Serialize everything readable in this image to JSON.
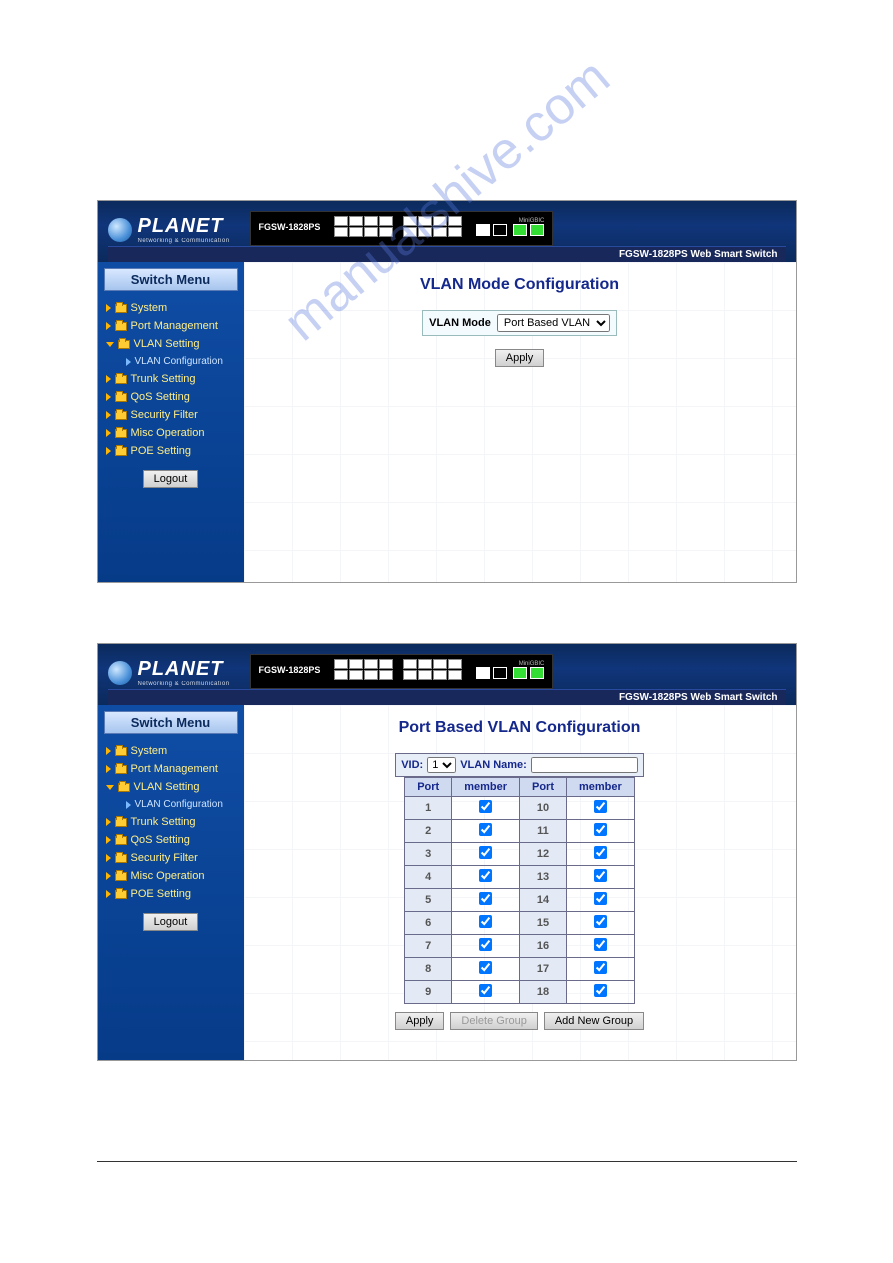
{
  "brand": {
    "name": "PLANET",
    "tagline": "Networking & Communication"
  },
  "device_model": "FGSW-1828PS",
  "minigbic_label": "MiniGBIC",
  "header_tag": "FGSW-1828PS Web Smart Switch",
  "sidebar": {
    "title": "Switch Menu",
    "items": [
      {
        "label": "System"
      },
      {
        "label": "Port Management"
      },
      {
        "label": "VLAN Setting",
        "expanded": true
      },
      {
        "label": "VLAN Configuration",
        "sub": true
      },
      {
        "label": "Trunk Setting"
      },
      {
        "label": "QoS Setting"
      },
      {
        "label": "Security Filter"
      },
      {
        "label": "Misc Operation"
      },
      {
        "label": "POE Setting"
      }
    ],
    "logout": "Logout"
  },
  "screen1": {
    "title": "VLAN Mode Configuration",
    "mode_label": "VLAN Mode",
    "mode_value": "Port Based VLAN",
    "apply": "Apply"
  },
  "screen2": {
    "title": "Port Based VLAN Configuration",
    "vid_label": "VID:",
    "vid_value": "1",
    "vlan_name_label": "VLAN Name:",
    "vlan_name_value": "",
    "col_port": "Port",
    "col_member": "member",
    "rows": [
      {
        "a": "1",
        "b": "10"
      },
      {
        "a": "2",
        "b": "11"
      },
      {
        "a": "3",
        "b": "12"
      },
      {
        "a": "4",
        "b": "13"
      },
      {
        "a": "5",
        "b": "14"
      },
      {
        "a": "6",
        "b": "15"
      },
      {
        "a": "7",
        "b": "16"
      },
      {
        "a": "8",
        "b": "17"
      },
      {
        "a": "9",
        "b": "18"
      }
    ],
    "apply": "Apply",
    "delete": "Delete Group",
    "add": "Add New Group"
  },
  "watermark": "manualshive.com"
}
